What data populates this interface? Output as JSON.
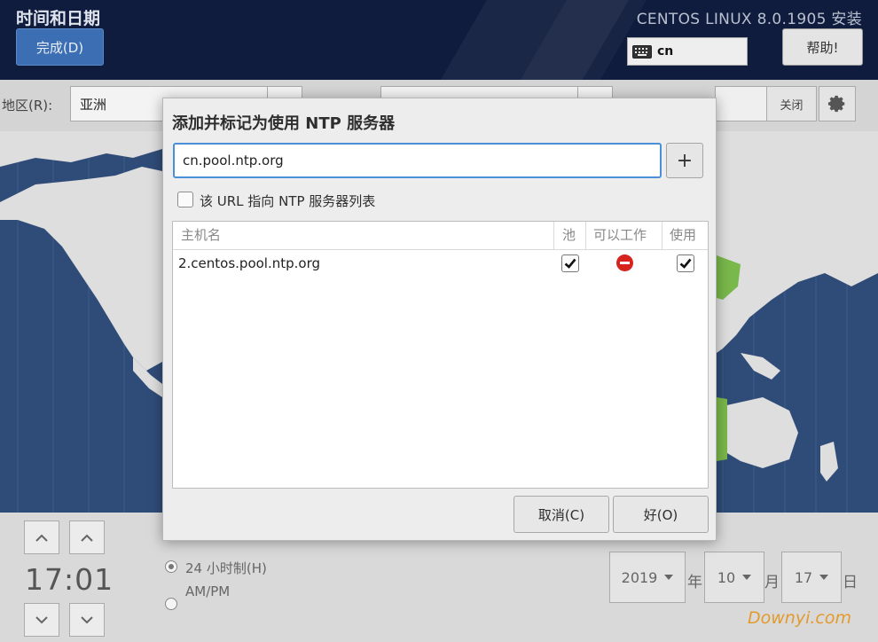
{
  "header": {
    "page_title": "时间和日期",
    "done_label": "完成(D)",
    "install_title": "CENTOS LINUX 8.0.1905 安装",
    "keyboard_layout": "cn",
    "help_label": "帮助!"
  },
  "toolbar": {
    "region_label": "地区(R):",
    "region_value": "亚洲",
    "ntp_close_label": "关闭"
  },
  "dialog": {
    "title": "添加并标记为使用 NTP 服务器",
    "server_input_value": "cn.pool.ntp.org",
    "add_label": "+",
    "url_checkbox_label": "该 URL 指向 NTP 服务器列表",
    "url_checked": false,
    "columns": [
      "主机名",
      "池",
      "可以工作",
      "使用"
    ],
    "rows": [
      {
        "hostname": "2.centos.pool.ntp.org",
        "pool": true,
        "working": false,
        "use": true
      }
    ],
    "cancel_label": "取消(C)",
    "ok_label": "好(O)"
  },
  "bottom": {
    "time": "17:01",
    "format_24h_label": "24 小时制(H)",
    "format_ampm_label": "AM/PM",
    "format_selected": "24h",
    "year": "2019",
    "year_unit": "年",
    "month": "10",
    "month_unit": "月",
    "day": "17",
    "day_unit": "日"
  },
  "watermark": "Downyi.com",
  "colors": {
    "accent": "#3c6eb4",
    "focus": "#4a90d9",
    "ocean": "#2f4c78",
    "land": "#dedede",
    "timezone_highlight": "#79b84b",
    "error": "#d6231e"
  }
}
